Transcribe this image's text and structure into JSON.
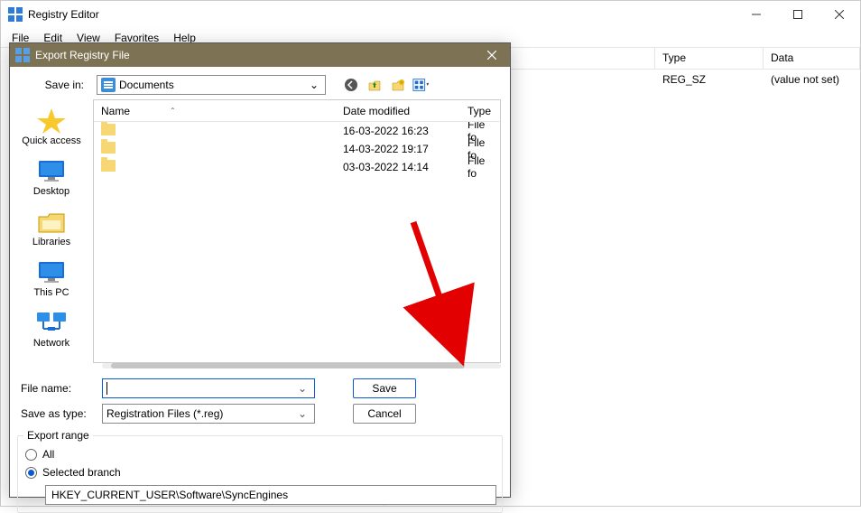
{
  "app": {
    "title": "Registry Editor",
    "menus": [
      "File",
      "Edit",
      "View",
      "Favorites",
      "Help"
    ]
  },
  "main_list": {
    "columns": {
      "type": "Type",
      "data": "Data"
    },
    "rows": [
      {
        "type": "REG_SZ",
        "data": "(value not set)"
      }
    ]
  },
  "dialog": {
    "title": "Export Registry File",
    "save_in_label": "Save in:",
    "save_in_value": "Documents",
    "places": {
      "quick_access": "Quick access",
      "desktop": "Desktop",
      "libraries": "Libraries",
      "this_pc": "This PC",
      "network": "Network"
    },
    "filelist": {
      "columns": {
        "name": "Name",
        "date": "Date modified",
        "type": "Type"
      },
      "rows": [
        {
          "name": "",
          "date": "16-03-2022 16:23",
          "type": "File fo"
        },
        {
          "name": "",
          "date": "14-03-2022 19:17",
          "type": "File fo"
        },
        {
          "name": "",
          "date": "03-03-2022 14:14",
          "type": "File fo"
        }
      ]
    },
    "filename_label": "File name:",
    "filename_value": "",
    "saveas_label": "Save as type:",
    "saveas_value": "Registration Files (*.reg)",
    "save_btn": "Save",
    "cancel_btn": "Cancel",
    "export_range": {
      "legend": "Export range",
      "all": "All",
      "selected": "Selected branch",
      "branch_path": "HKEY_CURRENT_USER\\Software\\SyncEngines"
    }
  }
}
